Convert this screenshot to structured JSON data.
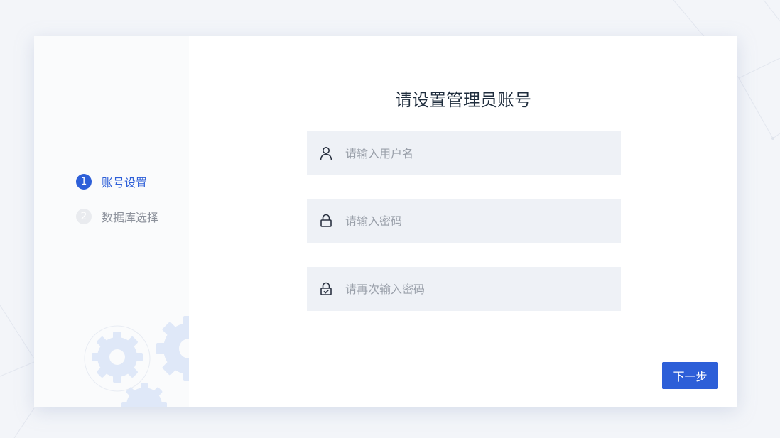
{
  "steps": [
    {
      "number": "1",
      "label": "账号设置",
      "state": "active"
    },
    {
      "number": "2",
      "label": "数据库选择",
      "state": "inactive"
    }
  ],
  "form": {
    "title": "请设置管理员账号",
    "username": {
      "icon": "user-icon",
      "placeholder": "请输入用户名",
      "value": ""
    },
    "password": {
      "icon": "lock-icon",
      "placeholder": "请输入密码",
      "value": ""
    },
    "confirm_password": {
      "icon": "lock-check-icon",
      "placeholder": "请再次输入密码",
      "value": ""
    }
  },
  "actions": {
    "next_label": "下一步"
  },
  "colors": {
    "accent": "#2d5fd8",
    "background": "#f3f5f9",
    "input_bg": "#eef1f6",
    "inactive_step": "#e9ebef"
  }
}
